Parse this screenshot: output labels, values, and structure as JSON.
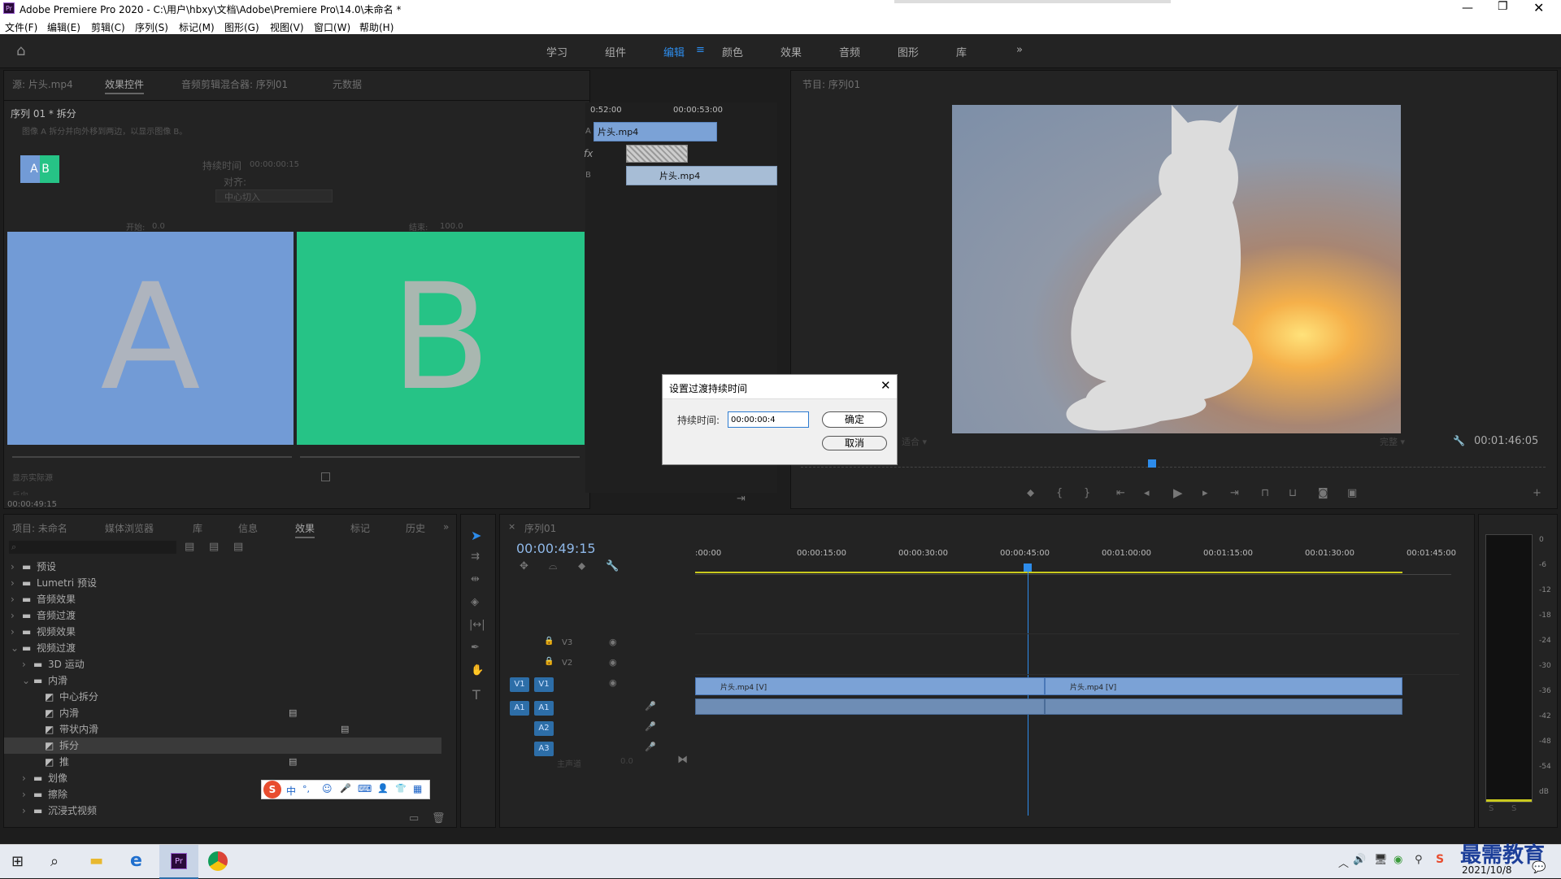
{
  "window": {
    "title": "Adobe Premiere Pro 2020 - C:\\用户\\hbxy\\文档\\Adobe\\Premiere Pro\\14.0\\未命名 *",
    "app_icon": "Pr"
  },
  "menu": [
    "文件(F)",
    "编辑(E)",
    "剪辑(C)",
    "序列(S)",
    "标记(M)",
    "图形(G)",
    "视图(V)",
    "窗口(W)",
    "帮助(H)"
  ],
  "workspaces": [
    "学习",
    "组件",
    "编辑",
    "颜色",
    "效果",
    "音频",
    "图形",
    "库"
  ],
  "workspace_active": "编辑",
  "source_panel": {
    "tabs": [
      "源: 片头.mp4",
      "效果控件",
      "音频剪辑混合器: 序列01",
      "元数据"
    ],
    "header": "序列 01 * 拆分",
    "description": "图像 A 拆分并向外移到两边，以显示图像 B。",
    "duration_label": "持续时间",
    "duration_value": "00:00:00:15",
    "align_label": "对齐:",
    "align_value": "中心切入",
    "start_label": "开始:",
    "start_value": "0.0",
    "end_label": "结束:",
    "end_value": "100.0",
    "thumb_label": "A B",
    "preview_a": "A",
    "preview_b": "B",
    "show_actual": "显示实际源",
    "reverse": "反向",
    "timecode": "00:00:49:15",
    "mini_ruler": [
      "0:52:00",
      "00:00:53:00"
    ],
    "mini_track_a": "A",
    "mini_track_b": "B",
    "mini_fx": "fx",
    "clip_a": "片头.mp4",
    "clip_b": "片头.mp4"
  },
  "program_panel": {
    "tab": "节目: 序列01",
    "fit": "适合",
    "quality": "完整",
    "timecode": "00:01:46:05"
  },
  "dialog": {
    "title": "设置过渡持续时间",
    "label": "持续时间:",
    "value": "00:00:00:4",
    "ok": "确定",
    "cancel": "取消"
  },
  "project_panel": {
    "tabs": [
      "项目: 未命名",
      "媒体浏览器",
      "库",
      "信息",
      "效果",
      "标记",
      "历史"
    ],
    "active_tab": "效果",
    "tree": [
      {
        "label": "预设",
        "level": 0,
        "type": "folder"
      },
      {
        "label": "Lumetri 预设",
        "level": 0,
        "type": "folder"
      },
      {
        "label": "音频效果",
        "level": 0,
        "type": "folder"
      },
      {
        "label": "音频过渡",
        "level": 0,
        "type": "folder"
      },
      {
        "label": "视频效果",
        "level": 0,
        "type": "folder"
      },
      {
        "label": "视频过渡",
        "level": 0,
        "type": "folder",
        "open": true
      },
      {
        "label": "3D 运动",
        "level": 1,
        "type": "folder"
      },
      {
        "label": "内滑",
        "level": 1,
        "type": "folder",
        "open": true
      },
      {
        "label": "中心拆分",
        "level": 2,
        "type": "item"
      },
      {
        "label": "内滑",
        "level": 2,
        "type": "item",
        "badge": true
      },
      {
        "label": "带状内滑",
        "level": 2,
        "type": "item",
        "badge": true
      },
      {
        "label": "拆分",
        "level": 2,
        "type": "item",
        "selected": true
      },
      {
        "label": "推",
        "level": 2,
        "type": "item",
        "badge": true
      },
      {
        "label": "划像",
        "level": 1,
        "type": "folder"
      },
      {
        "label": "擦除",
        "level": 1,
        "type": "folder"
      },
      {
        "label": "沉浸式视频",
        "level": 1,
        "type": "folder"
      }
    ],
    "ime": [
      "中",
      "°,",
      "☺",
      "🎤",
      "⌨",
      "👤",
      "👕",
      "▦"
    ]
  },
  "timeline": {
    "tab": "序列01",
    "timecode": "00:00:49:15",
    "ruler": [
      ":00:00",
      "00:00:15:00",
      "00:00:30:00",
      "00:00:45:00",
      "00:01:00:00",
      "00:01:15:00",
      "00:01:30:00",
      "00:01:45:00"
    ],
    "video_tracks": [
      "V3",
      "V2",
      "V1"
    ],
    "audio_tracks": [
      "A1",
      "A2",
      "A3"
    ],
    "master": "主声道",
    "master_value": "0.0",
    "source_v": "V1",
    "source_a": "A1",
    "clip1": "片头.mp4 [V]",
    "clip2": "片头.mp4 [V]"
  },
  "meter": {
    "scale": [
      "0",
      "-6",
      "-12",
      "-18",
      "-24",
      "-30",
      "-36",
      "-42",
      "-48",
      "-54",
      "dB"
    ],
    "s_buttons": [
      "S",
      "S"
    ]
  },
  "taskbar": {
    "date": "2021/10/8",
    "watermark": "最需教育"
  },
  "colors": {
    "accent": "#2d8ceb",
    "clip_video": "#7ba2d6",
    "preview_a": "#729bd6",
    "preview_b": "#26c386"
  }
}
